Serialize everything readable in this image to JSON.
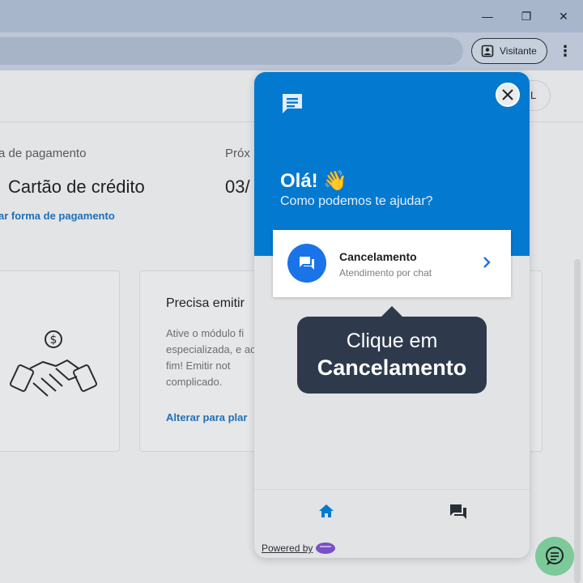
{
  "browser": {
    "minimize_glyph": "—",
    "restore_glyph": "❐",
    "close_glyph": "✕",
    "profile_label": "Visitante",
    "menu_glyph": "⋮"
  },
  "page": {
    "user_chip": "L",
    "payment_label": "a de pagamento",
    "payment_value": "Cartão de crédito",
    "payment_link": "ar forma de pagamento",
    "next_label": "Próx",
    "next_value": "03/",
    "card": {
      "title": "Precisa emitir",
      "desc": "Ative o módulo fi especializada, e ao fim! Emitir not complicado.",
      "link": "Alterar para plar"
    }
  },
  "widget": {
    "greeting": "Olá! 👋",
    "subtitle": "Como podemos te ajudar?",
    "option": {
      "title": "Cancelamento",
      "subtitle": "Atendimento por chat"
    },
    "powered_by": "Powered by",
    "accent_color": "#0379d0"
  },
  "tooltip": {
    "line1": "Clique em",
    "line2": "Cancelamento"
  }
}
